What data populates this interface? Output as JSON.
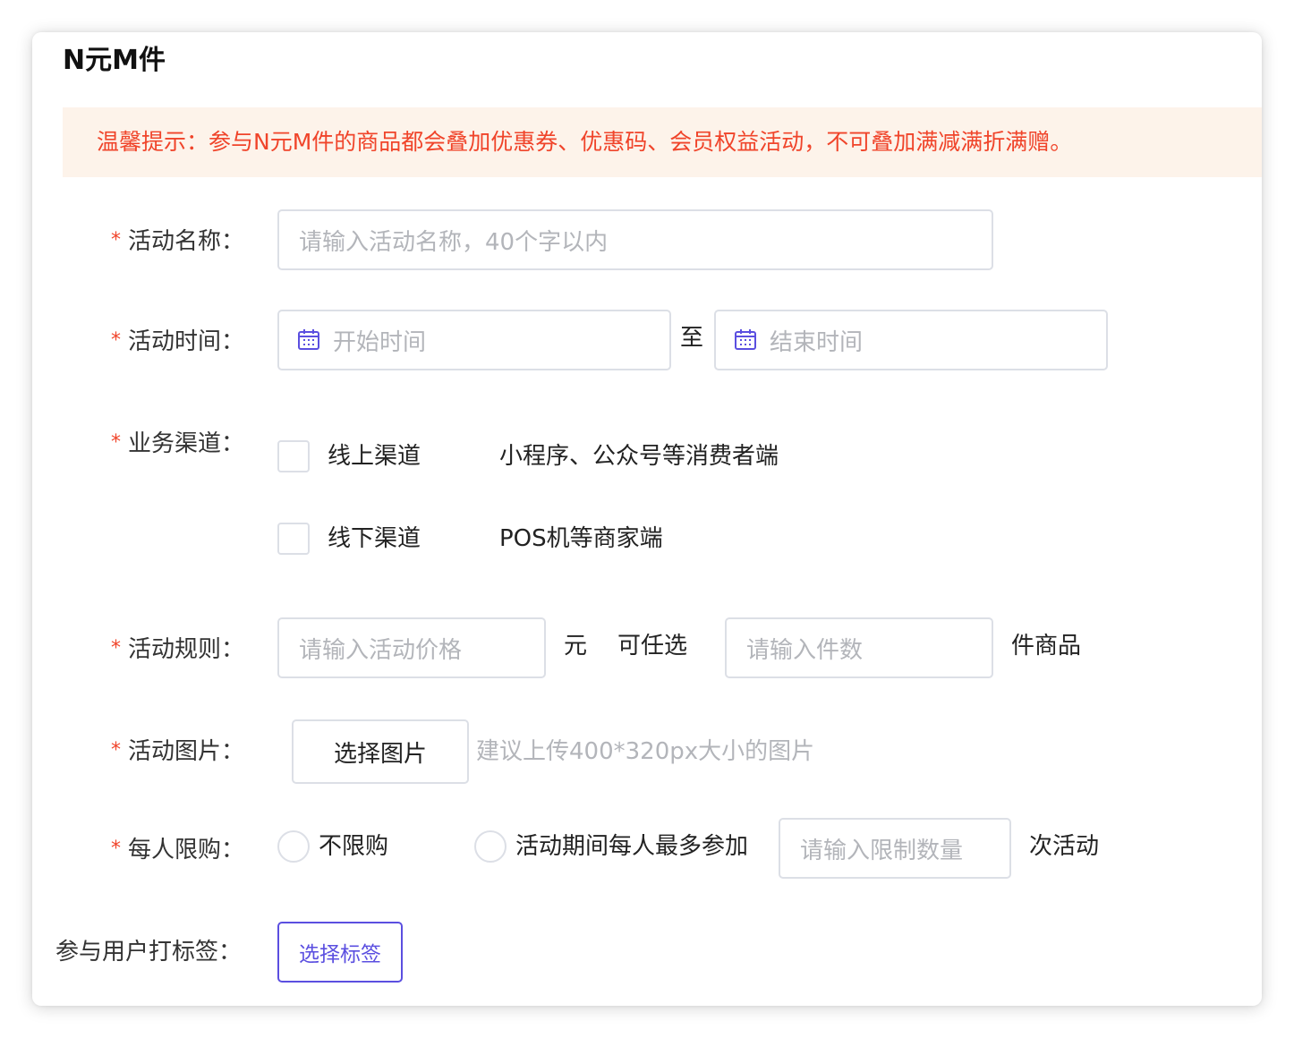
{
  "page": {
    "title": "N元M件",
    "notice": "温馨提示：参与N元M件的商品都会叠加优惠券、优惠码、会员权益活动，不可叠加满减满折满赠。"
  },
  "form": {
    "required_mark": "*",
    "name": {
      "label": "活动名称：",
      "placeholder": "请输入活动名称，40个字以内"
    },
    "time": {
      "label": "活动时间：",
      "start_placeholder": "开始时间",
      "separator": "至",
      "end_placeholder": "结束时间"
    },
    "channel": {
      "label": "业务渠道：",
      "options": [
        {
          "label": "线上渠道",
          "desc": "小程序、公众号等消费者端"
        },
        {
          "label": "线下渠道",
          "desc": "POS机等商家端"
        }
      ]
    },
    "rule": {
      "label": "活动规则：",
      "price_placeholder": "请输入活动价格",
      "unit_yuan": "元",
      "choose_text": "可任选",
      "count_placeholder": "请输入件数",
      "unit_items": "件商品"
    },
    "image": {
      "label": "活动图片：",
      "button": "选择图片",
      "hint": "建议上传400*320px大小的图片"
    },
    "limit": {
      "label": "每人限购：",
      "option_unlimited": "不限购",
      "option_limited": "活动期间每人最多参加",
      "limit_placeholder": "请输入限制数量",
      "suffix": "次活动"
    },
    "tag": {
      "label": "参与用户打标签：",
      "button": "选择标签"
    }
  },
  "colors": {
    "required": "#f0442a",
    "notice_bg": "#fdf3ea",
    "notice_text": "#f0442a",
    "accent": "#5b4fe0",
    "border": "#dcdfe6",
    "placeholder": "#b3b5ba"
  },
  "icons": {
    "date": "calendar-icon"
  }
}
